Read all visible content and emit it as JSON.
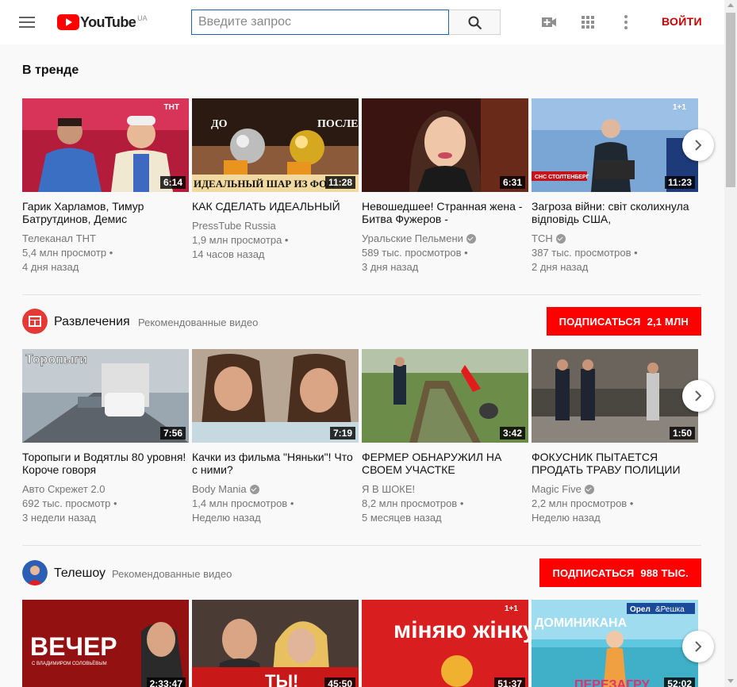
{
  "header": {
    "logo_text": "YouTube",
    "logo_region": "UA",
    "search_placeholder": "Введите запрос",
    "signin_label": "ВОЙТИ"
  },
  "trending": {
    "title": "В тренде",
    "videos": [
      {
        "title": "Гарик Харламов, Тимур Батрутдинов, Демис",
        "channel": "Телеканал ТНТ",
        "verified": false,
        "views": "5,4 млн просмотр",
        "age": "4 дня назад",
        "duration": "6:14"
      },
      {
        "title": "КАК СДЕЛАТЬ ИДЕАЛЬНЫЙ",
        "channel": "PressTube Russia",
        "verified": false,
        "views": "1,9 млн просмотра",
        "age": "14 часов назад",
        "duration": "11:28"
      },
      {
        "title": "Невошедшее! Странная жена - Битва Фужеров -",
        "channel": "Уральские Пельмени",
        "verified": true,
        "views": "589 тыс. просмотров",
        "age": "3 дня назад",
        "duration": "6:31"
      },
      {
        "title": "Загроза війни: світ сколихнула відповідь США,",
        "channel": "ТСН",
        "verified": true,
        "views": "387 тыс. просмотров",
        "age": "2 дня назад",
        "duration": "11:23"
      }
    ]
  },
  "entertainment": {
    "name": "Развлечения",
    "sub": "Рекомендованные видео",
    "subscribe_label": "ПОДПИСАТЬСЯ",
    "subscribe_count": "2,1 МЛН",
    "videos": [
      {
        "title": "Торопыги и Водятлы 80 уровня! Короче говоря",
        "channel": "Авто Скрежет 2.0",
        "verified": false,
        "views": "692 тыс. просмотр",
        "age": "3 недели назад",
        "duration": "7:56"
      },
      {
        "title": "Качки из фильма \"Няньки\"! Что с ними?",
        "channel": "Body Mania",
        "verified": true,
        "views": "1,4 млн просмотров",
        "age": "Неделю назад",
        "duration": "7:19"
      },
      {
        "title": "ФЕРМЕР ОБНАРУЖИЛ НА СВОЕМ УЧАСТКЕ",
        "channel": "Я В ШОКЕ!",
        "verified": false,
        "views": "8,2 млн просмотров",
        "age": "5 месяцев назад",
        "duration": "3:42"
      },
      {
        "title": "ФОКУСНИК ПЫТАЕТСЯ ПРОДАТЬ ТРАВУ ПОЛИЦИИ",
        "channel": "Magic Five",
        "verified": true,
        "views": "2,2 млн просмотров",
        "age": "Неделю назад",
        "duration": "1:50"
      }
    ]
  },
  "tvshow": {
    "name": "Телешоу",
    "sub": "Рекомендованные видео",
    "subscribe_label": "ПОДПИСАТЬСЯ",
    "subscribe_count": "988 ТЫС.",
    "videos": [
      {
        "duration": "2:33:47",
        "thumb_text": "ВЕЧЕР"
      },
      {
        "duration": "45:50",
        "thumb_text": "ТЫ!"
      },
      {
        "duration": "51:37",
        "thumb_text": "міняю жінку"
      },
      {
        "duration": "52:02",
        "thumb_text": "ДОМИНИКАНА"
      }
    ]
  },
  "thumb_texts": {
    "t1_badge": "ТНТ",
    "t2_left": "ДО",
    "t2_right": "ПОСЛЕ",
    "t2_bottom": "ИДЕАЛЬНЫЙ ШАР ИЗ ФОЛ",
    "t4_badge": "1+1",
    "t4_lower": "СНС СТОЛТЕНБЕРГ",
    "e1_title": "Торопыги",
    "tv1_sub": "С ВЛАДИМИРОМ СОЛОВЬЁВЫМ",
    "tv3_badge": "1+1",
    "tv4_badge1": "Орел",
    "tv4_badge2": "&Решка",
    "tv4_bottom": "ПЕРЕЗАГРУ"
  }
}
